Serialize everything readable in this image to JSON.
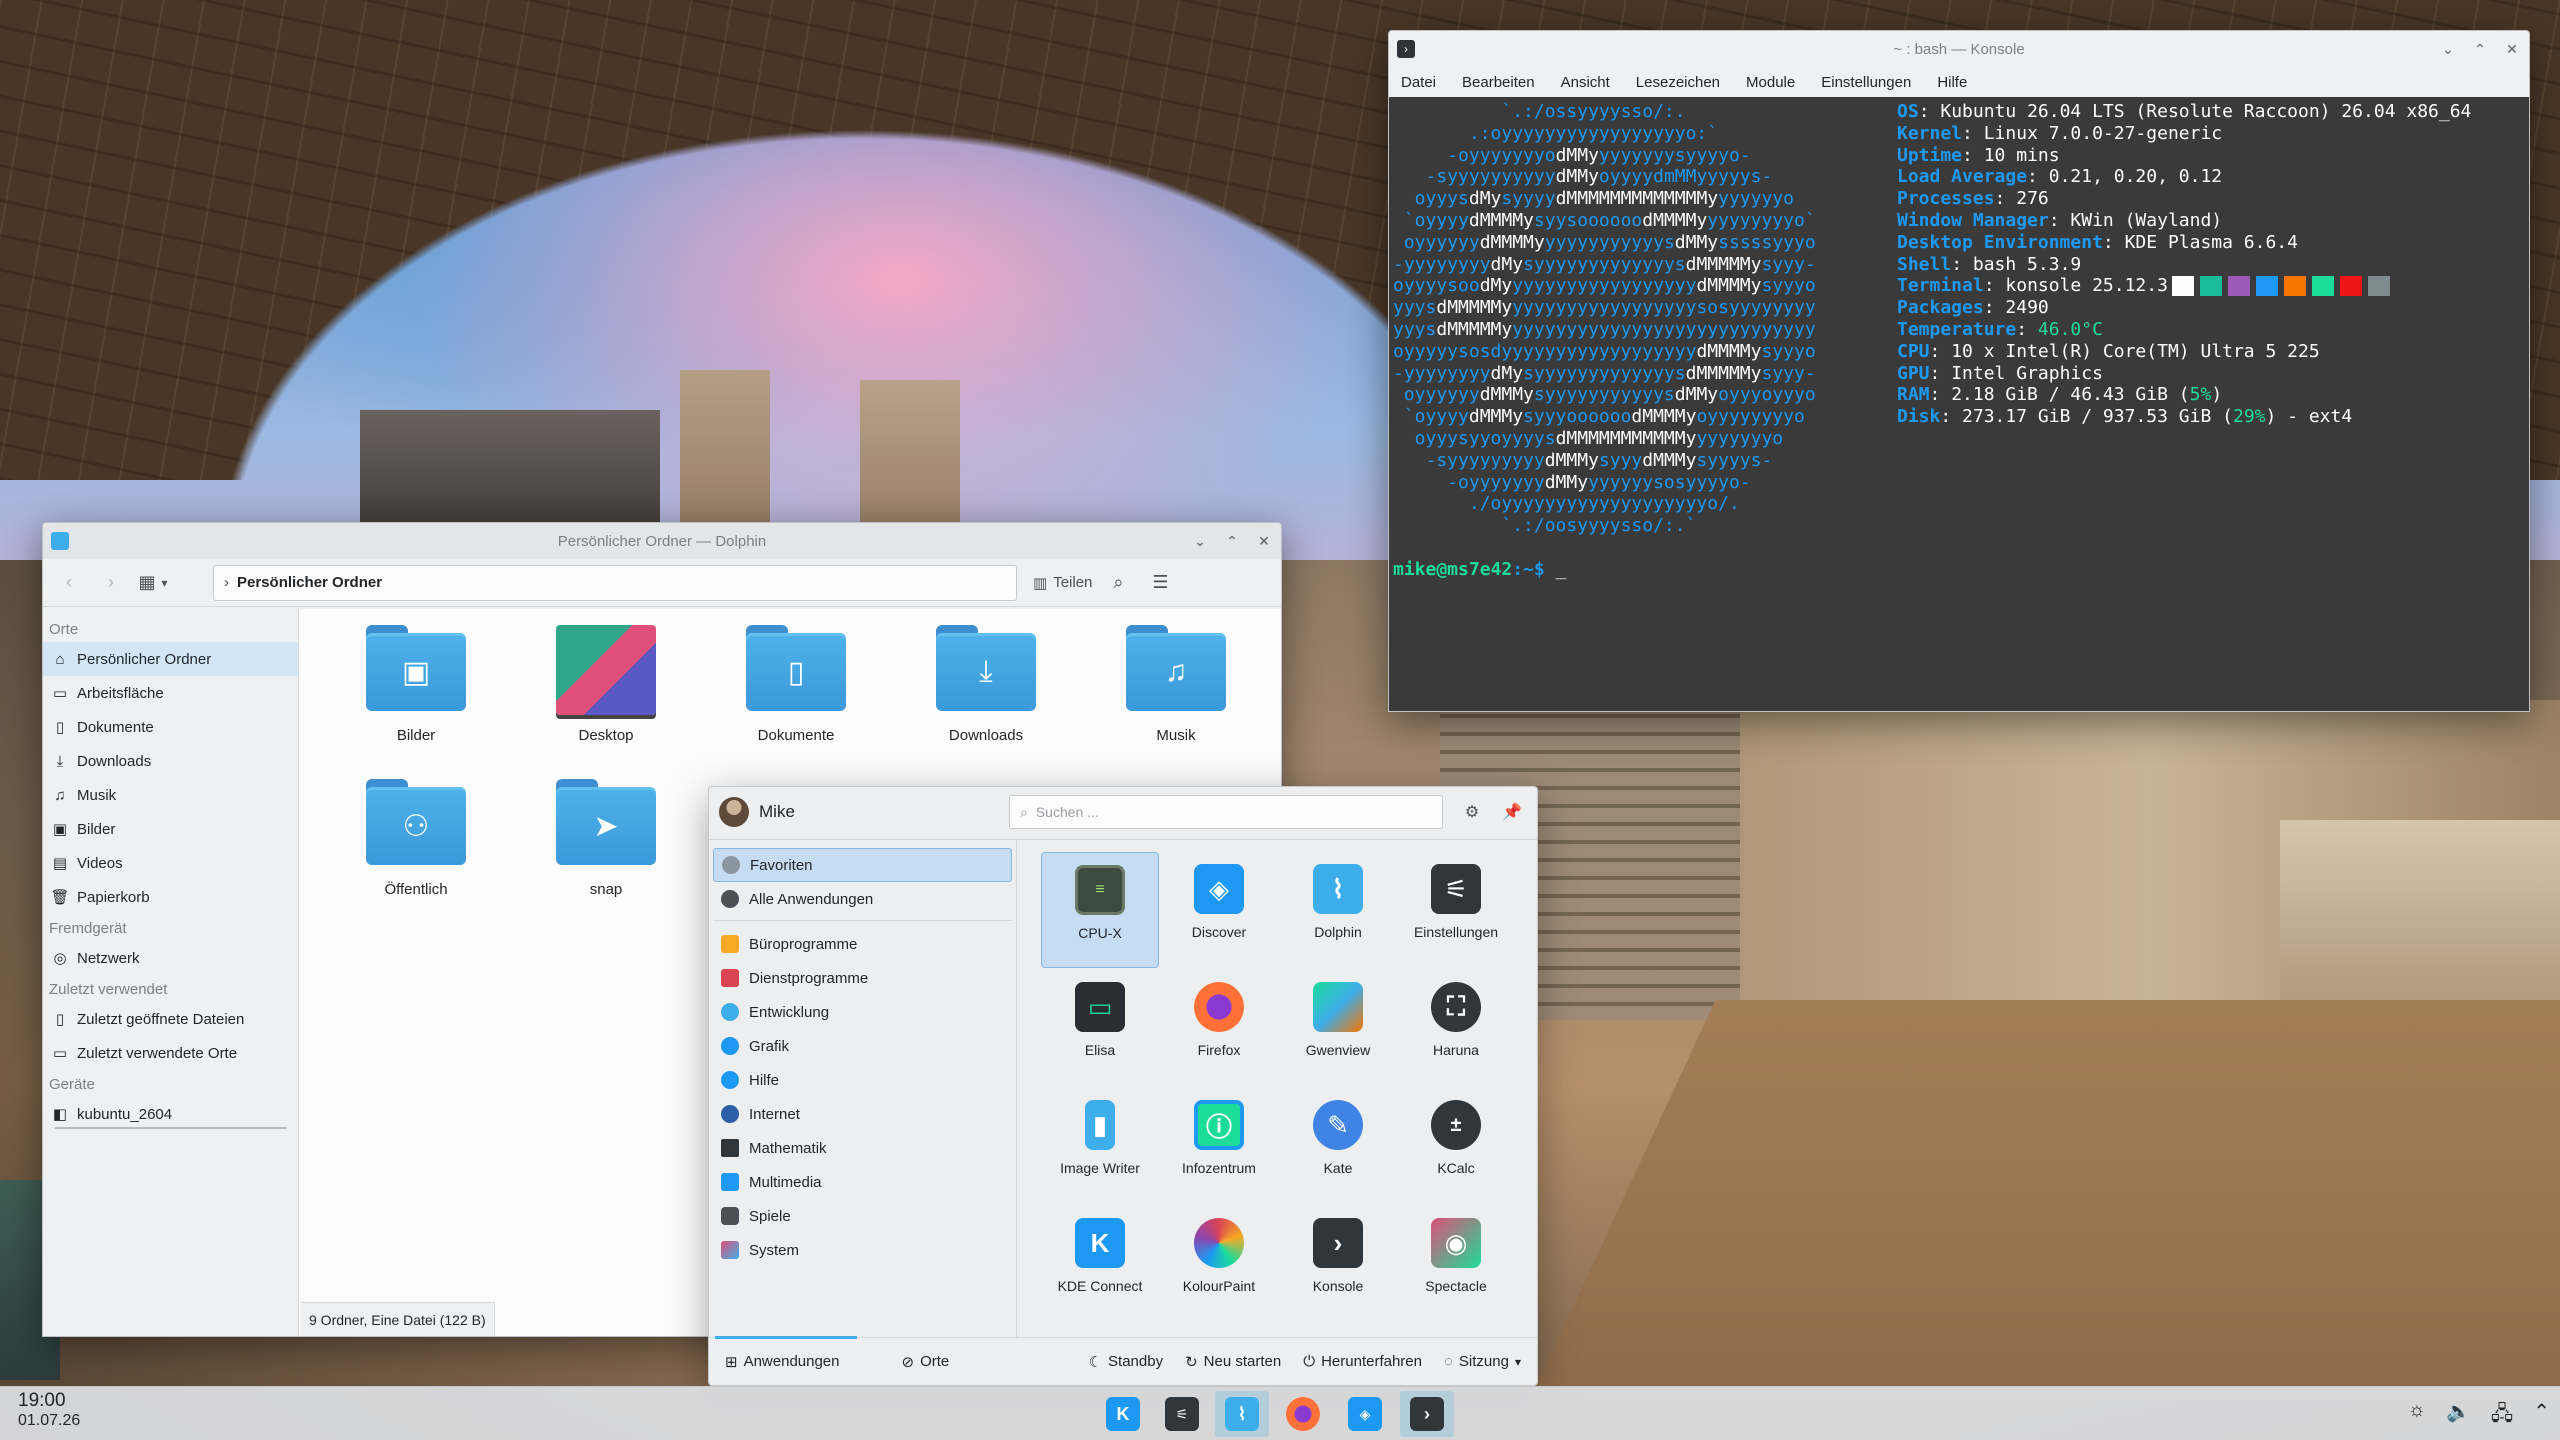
{
  "konsole": {
    "title": "~ : bash — Konsole",
    "menu": [
      "Datei",
      "Bearbeiten",
      "Ansicht",
      "Lesezeichen",
      "Module",
      "Einstellungen",
      "Hilfe"
    ],
    "logo": [
      "          `.:/ossyyyysso/:.",
      "       .:oyyyyyyyyyyyyyyyyyo:`",
      "     -oyyyyyyyodMMyyyyyyyysyyyyo-",
      "   -syyyyyyyyyydMMyoyyyydmMMyyyyys-",
      "  oyyysdMysyyyydMMMMMMMMMMMMMyyyyyyyo",
      " `oyyyydMMMMysyysoooooodMMMMyyyyyyyyyo`",
      " oyyyyyydMMMMyyyyyyyyyyyysdMMysssssyyyo",
      "-yyyyyyyydMysyyyyyyyyyyyyysdMMMMMysyyy-",
      "oyyyysoodMyyyyyyyyyyyyyyyyyydMMMMysyyyo",
      "yyysdMMMMMyyyyyyyyyyyyyyyyyysosyyyyyyyy",
      "yyysdMMMMMyyyyyyyyyyyyyyyyyyyyyyyyyyyyy",
      "oyyyyysosdyyyyyyyyyyyyyyyyyydMMMMysyyyo",
      "-yyyyyyyydMysyyyyyyyyyyyyysdMMMMMysyyy-",
      " oyyyyyydMMMysyyyyyyyyyyysdMMyoyyyoyyyo",
      " `oyyyydMMMysyyyoooooodMMMMyoyyyyyyyyo",
      "  oyyysyyoyyyysdMMMMMMMMMMMyyyyyyyyo",
      "   -syyyyyyyyydMMMysyyydMMMysyyyys-",
      "     -oyyyyyyydMMyyyyyyysosyyyyo-",
      "       ./oyyyyyyyyyyyyyyyyyyyo/.",
      "          `.:/oosyyyysso/:.`"
    ],
    "info": [
      {
        "k": "OS",
        "v": "Kubuntu 26.04 LTS (Resolute Raccoon) 26.04 x86_64"
      },
      {
        "k": "Kernel",
        "v": "Linux 7.0.0-27-generic"
      },
      {
        "k": "Uptime",
        "v": "10 mins"
      },
      {
        "k": "Load Average",
        "v": "0.21, 0.20, 0.12"
      },
      {
        "k": "Processes",
        "v": "276"
      },
      {
        "k": "Window Manager",
        "v": "KWin (Wayland)"
      },
      {
        "k": "Desktop Environment",
        "v": "KDE Plasma 6.6.4"
      },
      {
        "k": "Shell",
        "v": "bash 5.3.9"
      },
      {
        "k": "Terminal",
        "v": "konsole 25.12.3"
      },
      {
        "k": "Packages",
        "v": "2490"
      },
      {
        "k": "Temperature",
        "v": "46.0°C"
      },
      {
        "k": "CPU",
        "v": "10 x Intel(R) Core(TM) Ultra 5 225"
      },
      {
        "k": "GPU",
        "v": "Intel Graphics"
      },
      {
        "k": "RAM",
        "v": "2.18 GiB / 46.43 GiB (5%)"
      },
      {
        "k": "Disk",
        "v": "273.17 GiB / 937.53 GiB (29%) - ext4"
      }
    ],
    "swatch_colors": [
      "#fcfcfc",
      "#1abc9c",
      "#9b59b6",
      "#1d99f3",
      "#f67400",
      "#1cdc9a",
      "#ed1515",
      "#7f8c8d"
    ],
    "prompt_user": "mike@ms7e42",
    "prompt_path": ":~$",
    "cursor": " _"
  },
  "dolphin": {
    "title": "Persönlicher Ordner — Dolphin",
    "location": "Persönlicher Ordner",
    "share_label": "Teilen",
    "places": {
      "sections": {
        "orte": "Orte",
        "remote": "Fremdgerät",
        "recent": "Zuletzt verwendet",
        "devices": "Geräte"
      },
      "orte_items": [
        "Persönlicher Ordner",
        "Arbeitsfläche",
        "Dokumente",
        "Downloads",
        "Musik",
        "Bilder",
        "Videos",
        "Papierkorb"
      ],
      "remote_items": [
        "Netzwerk"
      ],
      "recent_items": [
        "Zuletzt geöffnete Dateien",
        "Zuletzt verwendete Orte"
      ],
      "device_items": [
        "kubuntu_2604"
      ]
    },
    "files": [
      "Bilder",
      "Desktop",
      "Dokumente",
      "Downloads",
      "Musik",
      "Öffentlich",
      "snap"
    ],
    "status": "9 Ordner, Eine Datei (122 B)"
  },
  "launcher": {
    "user": "Mike",
    "search_placeholder": "Suchen ...",
    "categories_top": [
      "Favoriten",
      "Alle Anwendungen"
    ],
    "categories": [
      "Büroprogramme",
      "Dienstprogramme",
      "Entwicklung",
      "Grafik",
      "Hilfe",
      "Internet",
      "Mathematik",
      "Multimedia",
      "Spiele",
      "System"
    ],
    "apps": [
      "CPU-X",
      "Discover",
      "Dolphin",
      "Einstellungen",
      "Elisa",
      "Firefox",
      "Gwenview",
      "Haruna",
      "Image Writer",
      "Infozentrum",
      "Kate",
      "KCalc",
      "KDE Connect",
      "KolourPaint",
      "Konsole",
      "Spectacle"
    ],
    "footer": {
      "apps": "Anwendungen",
      "places": "Orte",
      "sleep": "Standby",
      "restart": "Neu starten",
      "shutdown": "Herunterfahren",
      "session": "Sitzung"
    }
  },
  "panel": {
    "time": "19:00",
    "date": "01.07.26"
  }
}
